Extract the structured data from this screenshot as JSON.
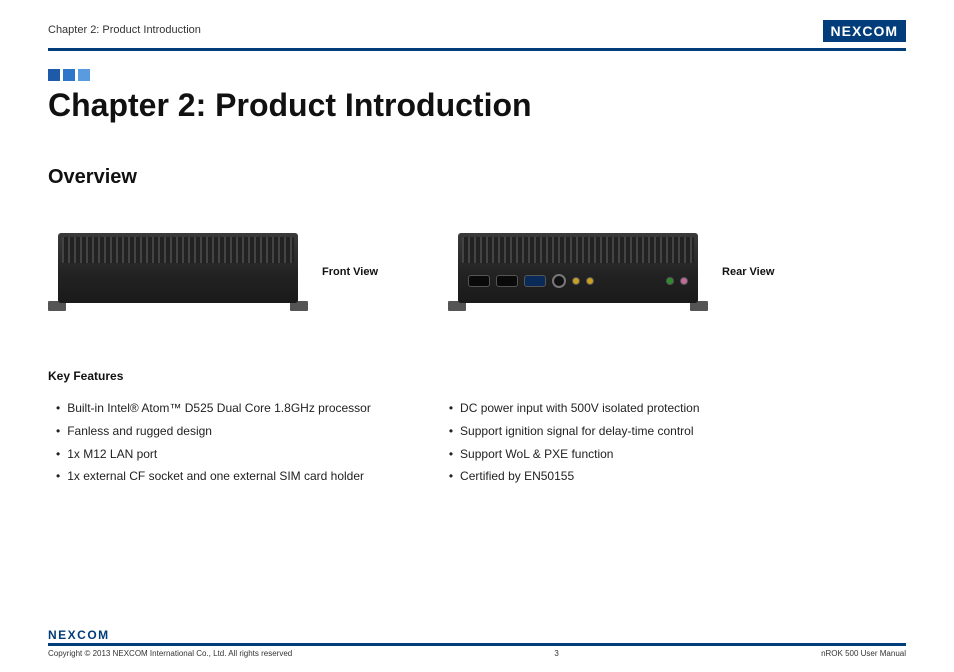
{
  "header": {
    "breadcrumb": "Chapter 2: Product Introduction",
    "brand": "NEXCOM"
  },
  "title": "Chapter 2: Product Introduction",
  "section": "Overview",
  "views": {
    "front_label": "Front View",
    "rear_label": "Rear View"
  },
  "features": {
    "heading": "Key Features",
    "left": [
      "Built-in Intel® Atom™ D525 Dual Core 1.8GHz processor",
      "Fanless and rugged design",
      "1x M12 LAN port",
      "1x external CF socket and one external SIM card holder"
    ],
    "right": [
      "DC power input with 500V isolated protection",
      "Support ignition signal for delay-time control",
      "Support WoL & PXE function",
      "Certified by EN50155"
    ]
  },
  "footer": {
    "brand": "NEXCOM",
    "copyright": "Copyright © 2013 NEXCOM International Co., Ltd. All rights reserved",
    "page": "3",
    "doc": "nROK 500 User Manual"
  }
}
